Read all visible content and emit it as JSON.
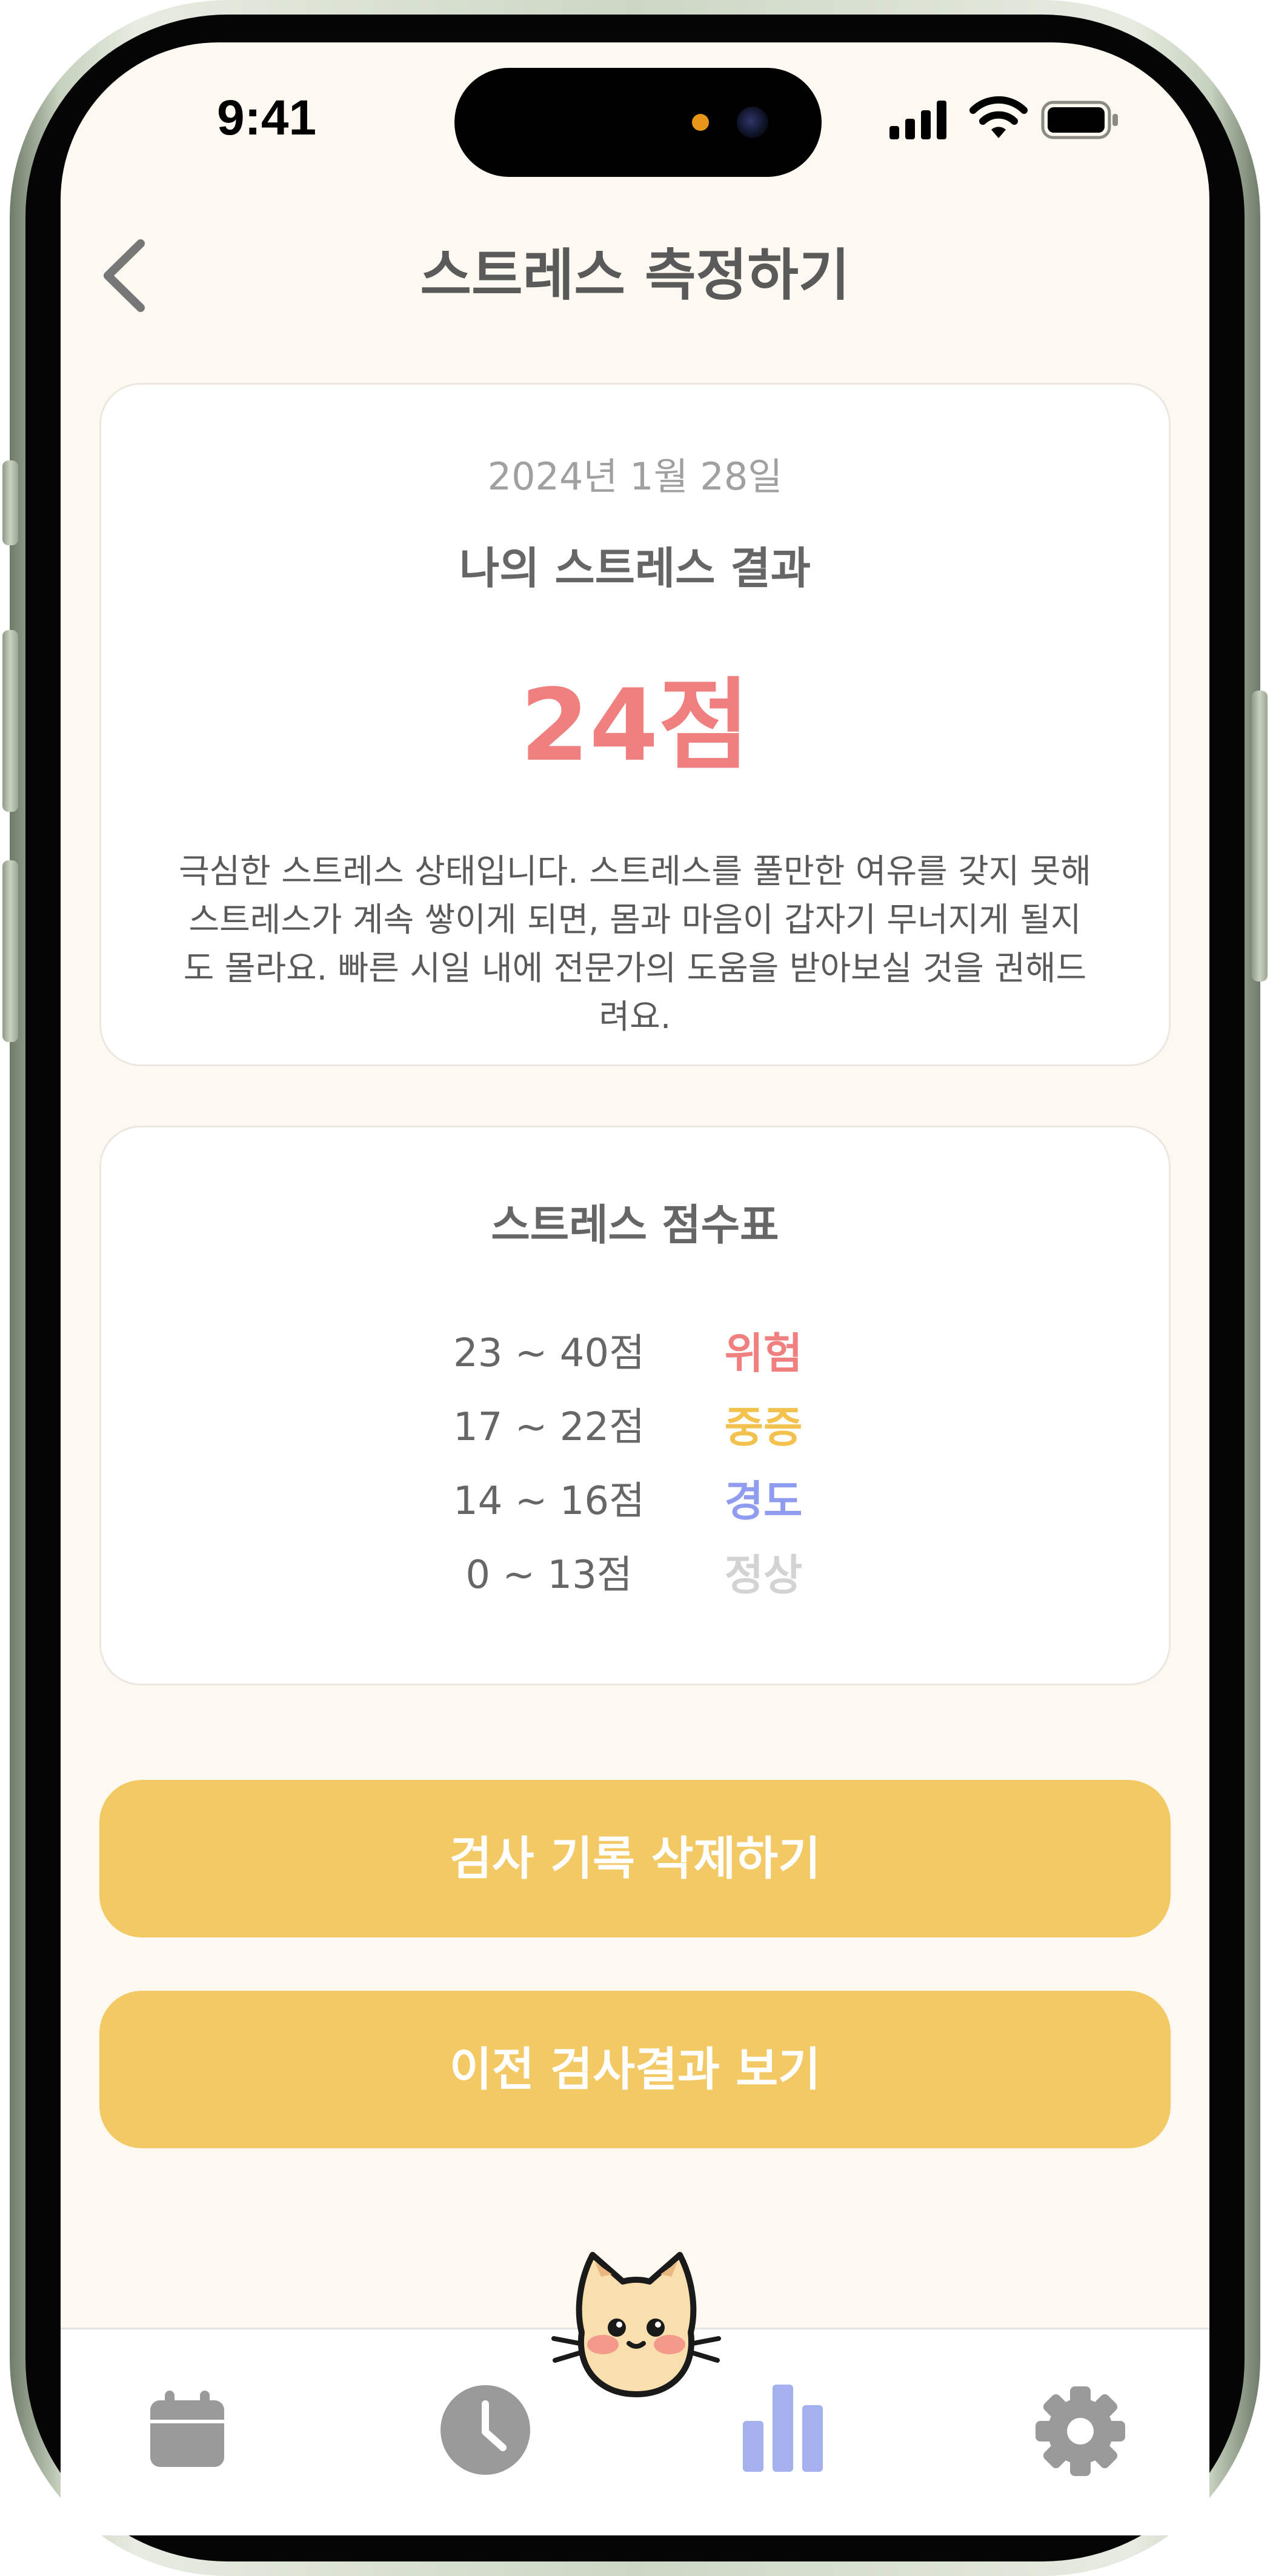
{
  "status_bar": {
    "time": "9:41"
  },
  "header": {
    "title": "스트레스 측정하기"
  },
  "result": {
    "date": "2024년 1월 28일",
    "heading": "나의 스트레스 결과",
    "score": "24점",
    "description": "극심한 스트레스 상태입니다. 스트레스를 풀만한 여유를 갖지 못해 스트레스가 계속 쌓이게 되면, 몸과 마음이 갑자기 무너지게 될지도 몰라요. 빠른 시일 내에 전문가의 도움을 받아보실 것을 권해드려요."
  },
  "score_table": {
    "title": "스트레스 점수표",
    "rows": [
      {
        "range": "23 ~ 40점",
        "level": "위험",
        "color": "#f08080"
      },
      {
        "range": "17 ~ 22점",
        "level": "중증",
        "color": "#f2c14e"
      },
      {
        "range": "14 ~ 16점",
        "level": "경도",
        "color": "#8f9cf0"
      },
      {
        "range": "0 ~ 13점",
        "level": "정상",
        "color": "#d3d3d3"
      }
    ]
  },
  "buttons": {
    "delete_label": "검사 기록 삭제하기",
    "history_label": "이전 검사결과 보기"
  },
  "tab_bar": {
    "tabs": [
      {
        "icon": "calendar-icon",
        "active": false
      },
      {
        "icon": "clock-icon",
        "active": false
      },
      {
        "icon": "bar-chart-icon",
        "active": true
      },
      {
        "icon": "gear-icon",
        "active": false
      }
    ],
    "active_color": "#a5b0ee",
    "inactive_color": "#9a9a9a"
  },
  "colors": {
    "background": "#fdf9f1",
    "accent": "#f2c964",
    "danger": "#f08080"
  }
}
